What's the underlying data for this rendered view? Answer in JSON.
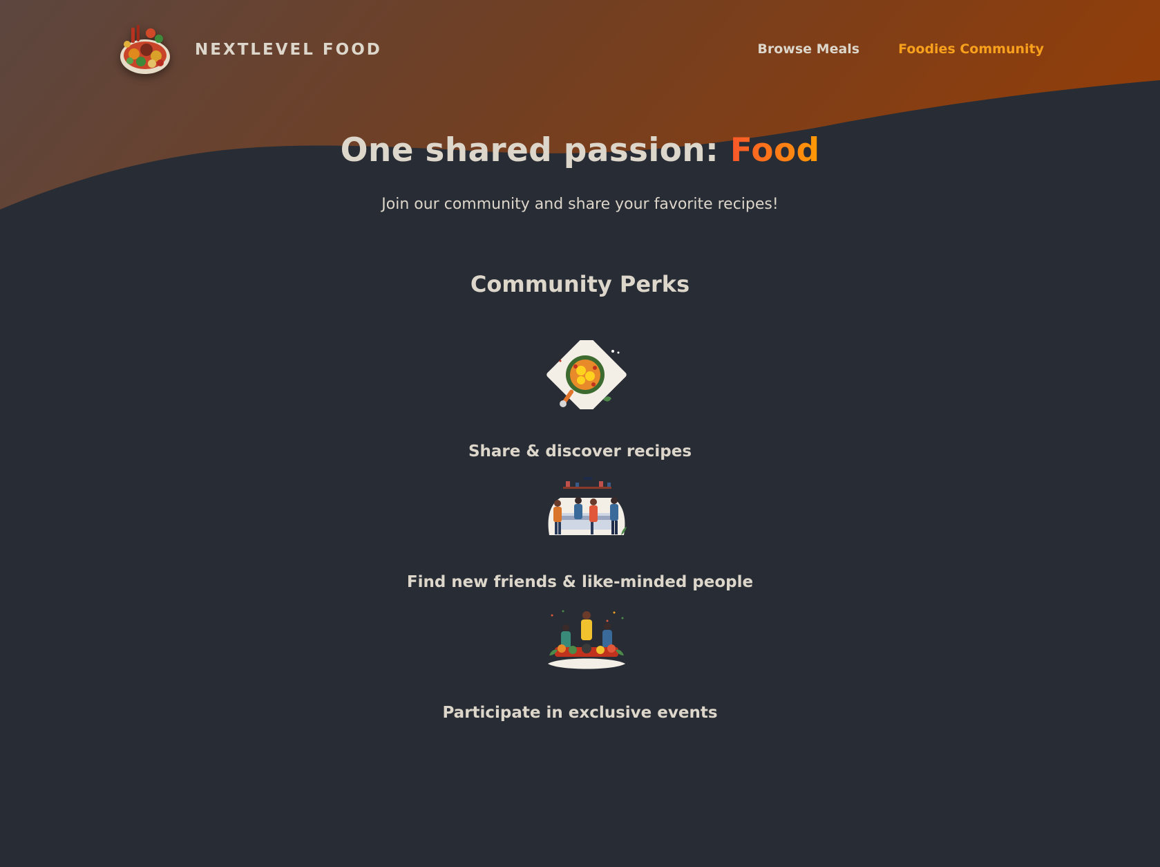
{
  "header": {
    "logo_alt": "A plate with food on it",
    "logo_text": "NextLevel Food",
    "nav": [
      {
        "label": "Browse Meals",
        "active": false
      },
      {
        "label": "Foodies Community",
        "active": true
      }
    ]
  },
  "hero": {
    "title_prefix": "One shared passion: ",
    "title_highlight": "Food",
    "subtitle": "Join our community and share your favorite recipes!"
  },
  "perks": {
    "title": "Community Perks",
    "items": [
      {
        "icon": "meal-illustration",
        "label": "Share & discover recipes"
      },
      {
        "icon": "community-kitchen-illustration",
        "label": "Find new friends & like-minded people"
      },
      {
        "icon": "cooking-event-illustration",
        "label": "Participate in exclusive events"
      }
    ]
  },
  "colors": {
    "background": "#282c34",
    "text": "#ddd6cb",
    "accent": "#f9a11d",
    "gradient_start": "#f9572a",
    "gradient_end": "#ff9b05",
    "header_wave_start": "#5c4b45",
    "header_wave_end": "#8b3f0c"
  }
}
